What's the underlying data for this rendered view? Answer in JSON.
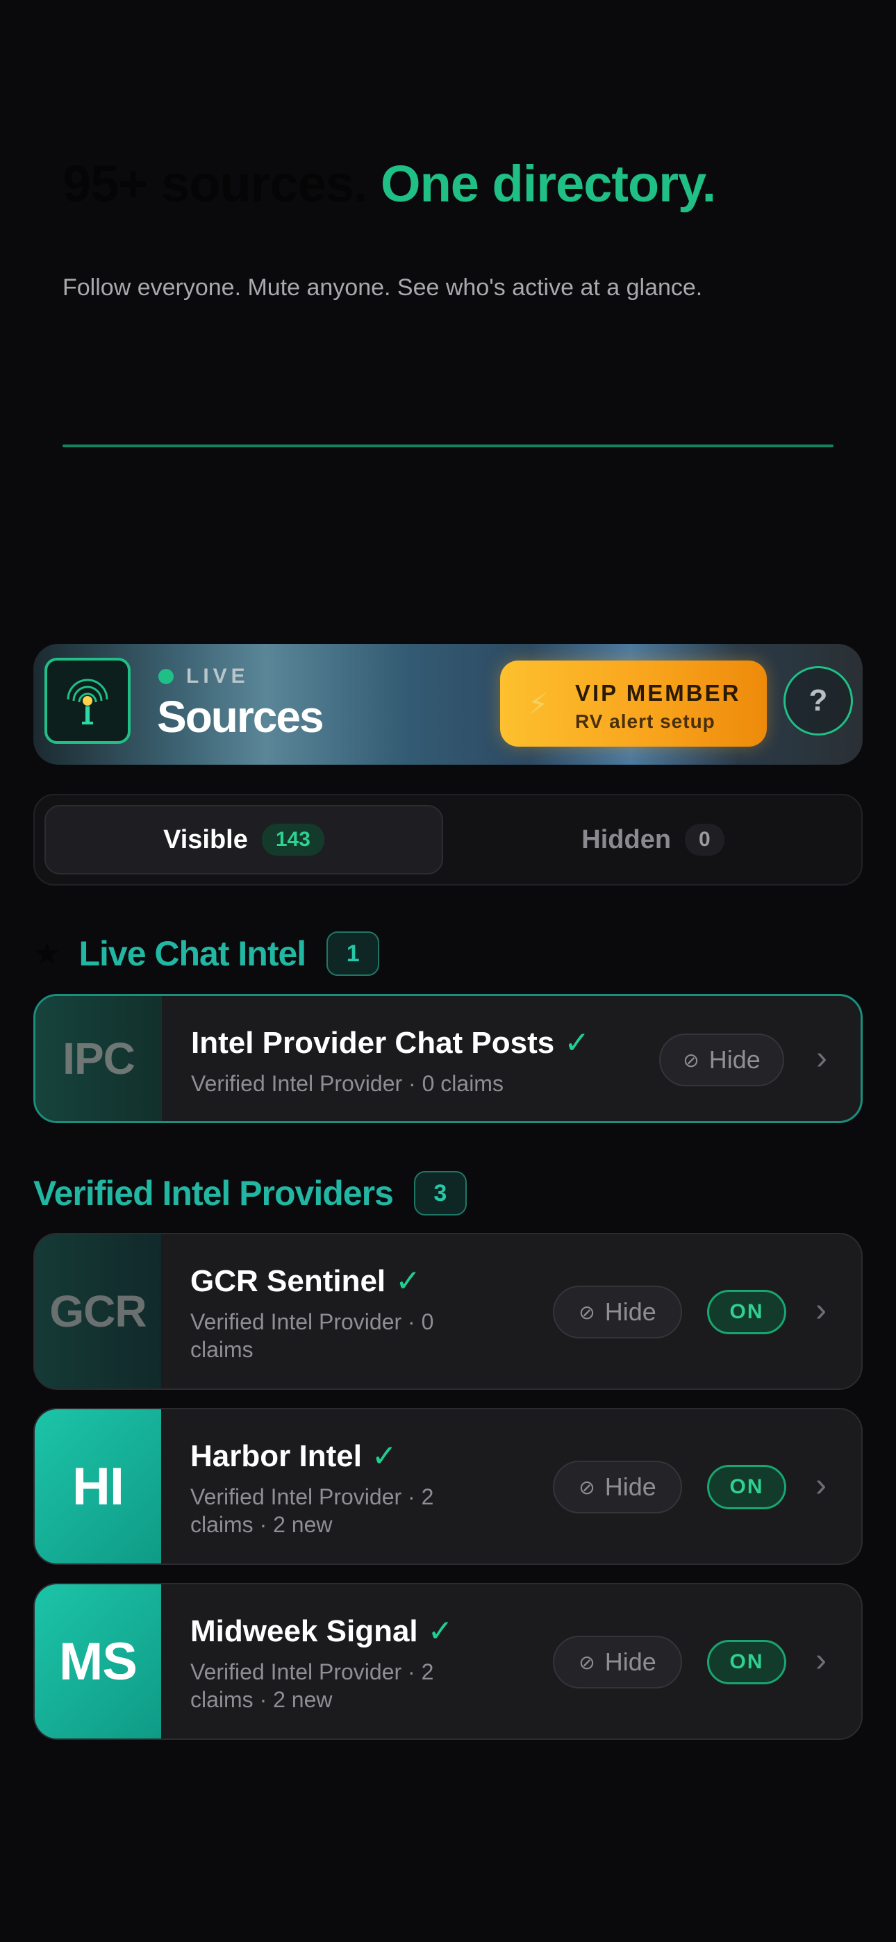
{
  "hero": {
    "title_muted": "95+ sources.",
    "title_accent": "One directory.",
    "subtitle": "Follow everyone. Mute anyone. See who's active at a glance."
  },
  "header": {
    "live_label": "LIVE",
    "title": "Sources",
    "vip_title": "VIP MEMBER",
    "vip_subtitle": "RV alert setup",
    "vip_icon": "lightning-icon",
    "help_label": "?"
  },
  "tabs": {
    "visible_label": "Visible",
    "visible_count": "143",
    "hidden_label": "Hidden",
    "hidden_count": "0"
  },
  "sections": [
    {
      "title": "Live Chat Intel",
      "count": "1",
      "items": [
        {
          "initials": "IPC",
          "name": "Intel Provider Chat Posts",
          "meta": "Verified Intel Provider  ·  0 claims",
          "hide_label": "Hide"
        }
      ]
    },
    {
      "title": "Verified Intel Providers",
      "count": "3",
      "items": [
        {
          "initials": "GCR",
          "name": "GCR Sentinel",
          "meta_line1": "Verified Intel Provider  ·  0",
          "meta_line2": "claims",
          "hide_label": "Hide",
          "status": "ON"
        },
        {
          "initials": "HI",
          "name": "Harbor Intel",
          "meta_line1": "Verified Intel Provider  ·  2",
          "meta_line2": "claims · 2 new",
          "hide_label": "Hide",
          "status": "ON"
        },
        {
          "initials": "MS",
          "name": "Midweek Signal",
          "meta_line1": "Verified Intel Provider  ·  2",
          "meta_line2": "claims · 2 new",
          "hide_label": "Hide",
          "status": "ON"
        }
      ]
    }
  ],
  "colors": {
    "accent_green": "#1fbf86",
    "accent_teal": "#22b7a3",
    "vip_orange": "#f9a51d"
  }
}
